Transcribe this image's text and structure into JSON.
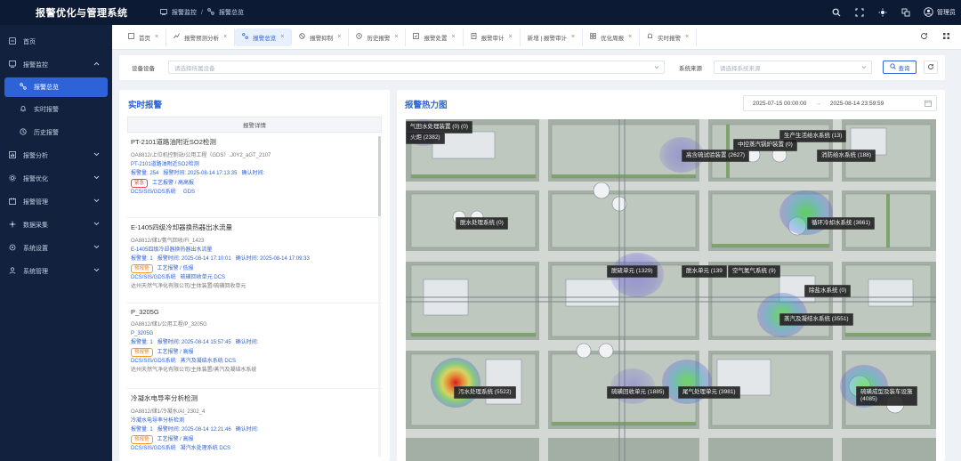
{
  "app": {
    "title": "报警优化与管理系统"
  },
  "breadcrumb": {
    "first": "报警监控",
    "separator": "/",
    "second": "报警总览"
  },
  "user": {
    "name": "管理员"
  },
  "sidebar": {
    "items": [
      {
        "label": "首页",
        "icon": "home-icon"
      },
      {
        "label": "报警监控",
        "icon": "monitor-icon",
        "expanded": true
      },
      {
        "label": "报警总览",
        "icon": "overview-icon",
        "active": true
      },
      {
        "label": "实时报警",
        "icon": "bell-icon"
      },
      {
        "label": "历史报警",
        "icon": "history-icon"
      },
      {
        "label": "报警分析",
        "icon": "chart-icon"
      },
      {
        "label": "报警优化",
        "icon": "gear-icon"
      },
      {
        "label": "报警管理",
        "icon": "manage-icon"
      },
      {
        "label": "数据采集",
        "icon": "collect-icon"
      },
      {
        "label": "系统设置",
        "icon": "settings-icon"
      },
      {
        "label": "系统管理",
        "icon": "admin-icon"
      }
    ]
  },
  "tabs": [
    {
      "label": "首页",
      "icon": "home-icon"
    },
    {
      "label": "报警预测分析",
      "icon": "predict-icon"
    },
    {
      "label": "报警总览",
      "icon": "overview-icon",
      "active": true
    },
    {
      "label": "报警抑制",
      "icon": "suppress-icon"
    },
    {
      "label": "历史报警",
      "icon": "history-icon"
    },
    {
      "label": "报警处置",
      "icon": "dispose-icon"
    },
    {
      "label": "报警审计",
      "icon": "audit-icon"
    },
    {
      "label": "新增 | 报警审计",
      "icon": "add-icon"
    },
    {
      "label": "优化周报",
      "icon": "report-icon"
    },
    {
      "label": "实时报警",
      "icon": "bell-icon"
    }
  ],
  "filters": {
    "device_label": "设备设备",
    "device_placeholder": "请选择所属设备",
    "source_label": "系统来源",
    "source_placeholder": "请选择系统来源",
    "query_label": "查询"
  },
  "realtime": {
    "title": "实时报警",
    "column_header": "报警详情",
    "alarms": [
      {
        "title": "PT-2101道路油附近SO2检测",
        "path": "OA8812/上位机控制站/公用工程（GDS）.J0Y2_aGT_2107",
        "desc": "PT-2101道路油附近SO2检测",
        "count": "报警量: 254",
        "time": "报警时间: 2025-08-14 17:13:35",
        "confirm": "确认时间:",
        "level": "紧急",
        "level2": "工艺报警 / 高高报",
        "system": "DCS/SIS/GDS系统",
        "system2": "GDS",
        "org": ""
      },
      {
        "title": "E-1405四级冷却器换热器出水流量",
        "path": "OA8812/储1/氨气回收/FI_1423",
        "desc": "E-1405四级冷却器换热器出水流量",
        "count": "报警量: 1",
        "time": "报警时间: 2025-08-14 17:10:01",
        "confirm": "确认时间: 2025-08-14 17:09:33",
        "level": "预报警",
        "level2": "工艺报警 / 低报",
        "system": "DCS/SIS/GDS系统",
        "system2": "硫磺回收单元    DCS",
        "org": "达州天然气净化有限公司/主体装置/硫磺回收单元"
      },
      {
        "title": "P_3205G",
        "path": "OA8812/储1/公用工程/P_3205G",
        "desc": "P_3205G",
        "count": "报警量: 1",
        "time": "报警时间: 2025-08-14 15:57:45",
        "confirm": "确认时间:",
        "level": "预报警",
        "level2": "工艺报警 / 高报",
        "system": "DCS/SIS/GDS系统",
        "system2": "蒸汽及凝结水系统    DCS",
        "org": "达州天然气净化有限公司/主体装置/蒸汽及凝结水系统"
      },
      {
        "title": "冷凝水电导率分析检测",
        "path": "OA8812/储1/冷凝水/AI_2302_4",
        "desc": "冷凝水电导率分析检测",
        "count": "报警量: 1",
        "time": "报警时间: 2025-08-14 12:21:46",
        "confirm": "确认时间:",
        "level": "预报警",
        "level2": "工艺报警 / 高报",
        "system": "DCS/SIS/GDS系统",
        "system2": "凝汽水处理系统    DCS",
        "org": ""
      }
    ]
  },
  "heatmap": {
    "title": "报警热力图",
    "date_start": "2025-07-15 00:00:00",
    "date_arrow": "→",
    "date_end": "2025-08-14 23:59:59",
    "labels": [
      {
        "id": "l1",
        "text": "气田水处理装置 (0)  (0)"
      },
      {
        "id": "l2",
        "text": "火炬 (2382)"
      },
      {
        "id": "l3",
        "text": "生产生活给水系统 (13)"
      },
      {
        "id": "l4",
        "text": "中控蒸汽锅炉装置 (0)"
      },
      {
        "id": "l5",
        "text": "高含硫试验装置 (2627)"
      },
      {
        "id": "l6",
        "text": "消防给水系统 (188)"
      },
      {
        "id": "l7",
        "text": "脱水处理系统 (0)"
      },
      {
        "id": "l8",
        "text": "循环冷却水系统 (3661)"
      },
      {
        "id": "l9",
        "text": "脱硫单元 (1329)"
      },
      {
        "id": "l10",
        "text": "脱水单元 (139"
      },
      {
        "id": "l11",
        "text": "空气氮气系统 (9)"
      },
      {
        "id": "l12",
        "text": "除盐水系统 (0)"
      },
      {
        "id": "l13",
        "text": "蒸汽及凝结水系统 (3551)"
      },
      {
        "id": "l14",
        "text": "污水处理系统 (5522)"
      },
      {
        "id": "l15",
        "text": "硫磺回收单元 (1885)"
      },
      {
        "id": "l16",
        "text": "尾气处理单元 (3981)"
      },
      {
        "id": "l17",
        "text": "硫磺成型及装车设施\n(4085)"
      }
    ]
  },
  "colors": {
    "topbar": "#0c1a33",
    "sidebar": "#12213d",
    "accent": "#2d62d8",
    "warning": "#f0871a"
  }
}
